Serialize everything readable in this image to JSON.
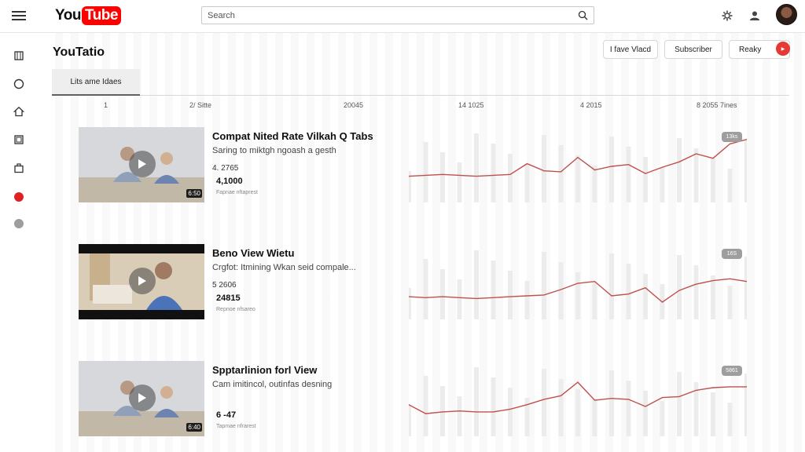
{
  "app": {
    "logo_left": "You",
    "logo_right": "Tube"
  },
  "search": {
    "placeholder": "Search"
  },
  "channel": {
    "title": "YouTatio"
  },
  "header_buttons": {
    "b1": "I fave Vlacd",
    "b2": "Subscriber",
    "b3": "Reaky"
  },
  "tab": {
    "label": "Lits ame Idaes"
  },
  "axis": {
    "t1": "1",
    "t2": "2/ Sitte",
    "t3": "20045",
    "t4": "14 1025",
    "t5": "4 2015",
    "t6": "8 2055 7ines"
  },
  "videos": [
    {
      "title": "Compat Nited Rate Vilkah Q Tabs",
      "desc": "Saring to miktgh ngoash a gesth",
      "stat1": "4. 2765",
      "stat2": "4,1000",
      "meta": "Fapnae nftaprest",
      "duration": "6:50",
      "pill": "13ks",
      "chart_data": {
        "type": "line",
        "values": [
          24,
          25,
          26,
          25,
          24,
          25,
          26,
          38,
          30,
          29,
          45,
          31,
          35,
          37,
          27,
          34,
          40,
          49,
          44,
          60,
          65
        ]
      }
    },
    {
      "title": "Beno View Wietu",
      "desc": "Crgfot: Itmining Wkan seid compale...",
      "stat1": "5 2606",
      "stat2": "24815",
      "meta": "Repnoe nfsareo",
      "duration": "",
      "pill": "16S",
      "chart_data": {
        "type": "line",
        "values": [
          20,
          19,
          20,
          19,
          18,
          19,
          20,
          21,
          22,
          28,
          35,
          37,
          21,
          23,
          30,
          14,
          27,
          34,
          38,
          40,
          37
        ]
      }
    },
    {
      "title": "Spptarlinion forl View",
      "desc": "Cam imitincol, outinfas desning",
      "stat1": "",
      "stat2": "6 -47",
      "meta": "Tapmae nfrarest",
      "duration": "6:40",
      "pill": "5861",
      "chart_data": {
        "type": "line",
        "values": [
          30,
          20,
          22,
          23,
          22,
          22,
          25,
          30,
          36,
          40,
          55,
          35,
          37,
          36,
          28,
          38,
          39,
          46,
          49,
          50,
          50
        ]
      }
    }
  ]
}
